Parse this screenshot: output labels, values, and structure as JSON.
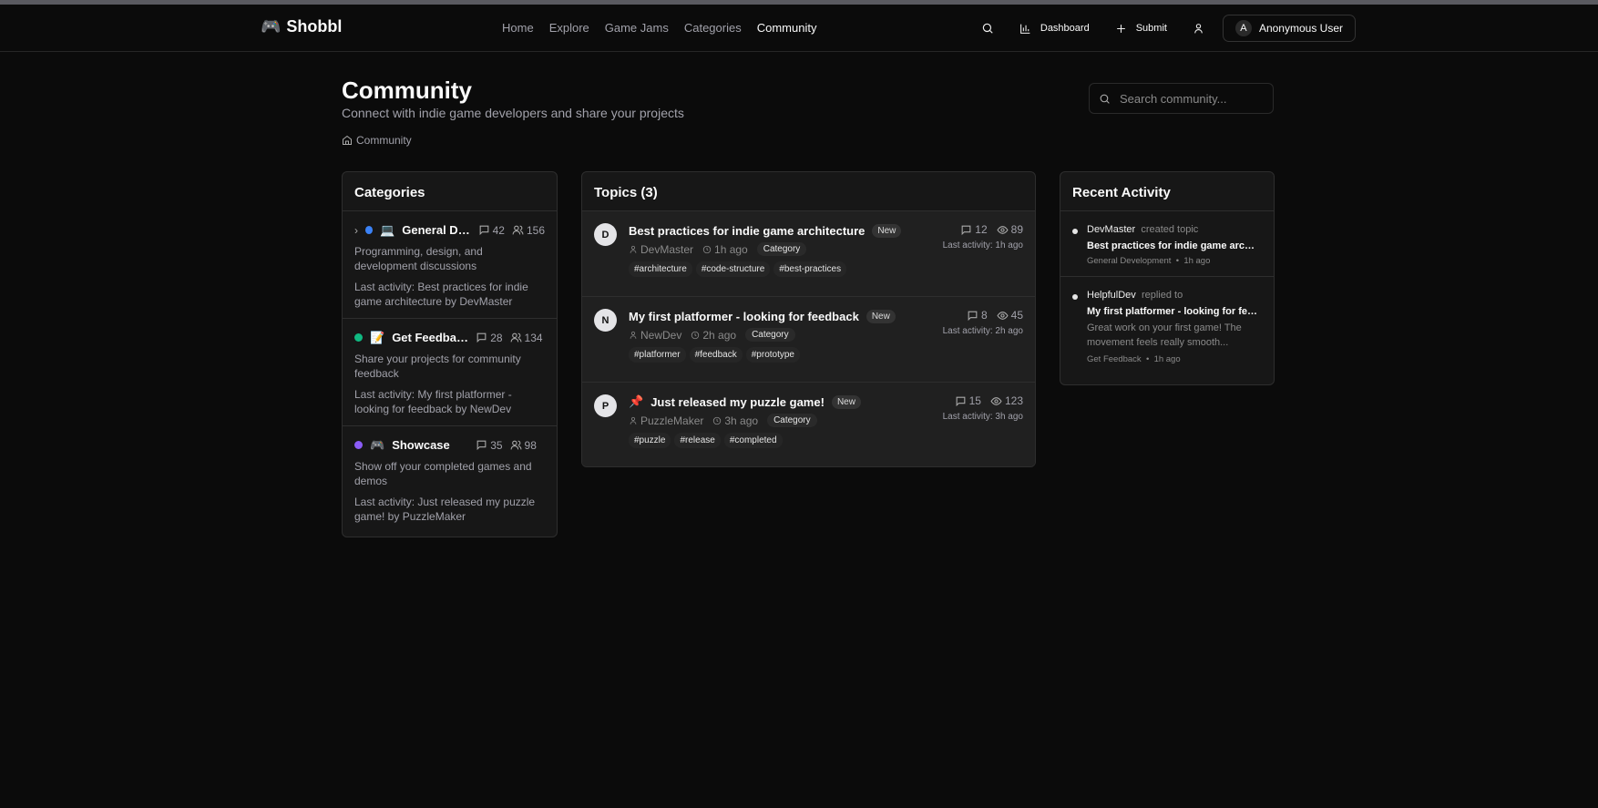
{
  "header": {
    "logo": "Shobbl",
    "logo_icon": "🎮",
    "nav": [
      "Home",
      "Explore",
      "Game Jams",
      "Categories",
      "Community"
    ],
    "active_nav": "Community",
    "dashboard": "Dashboard",
    "submit": "Submit",
    "user_initial": "A",
    "user_name": "Anonymous User"
  },
  "page": {
    "title": "Community",
    "subtitle": "Connect with indie game developers and share your projects",
    "breadcrumb": "Community",
    "search_placeholder": "Search community..."
  },
  "categories": {
    "title": "Categories",
    "items": [
      {
        "emoji": "💻",
        "name": "General Development",
        "color": "#3b82f6",
        "topics": "42",
        "members": "156",
        "desc": "Programming, design, and development discussions",
        "last": "Last activity: Best practices for indie game architecture by DevMaster"
      },
      {
        "emoji": "📝",
        "name": "Get Feedback",
        "color": "#10b981",
        "topics": "28",
        "members": "134",
        "desc": "Share your projects for community feedback",
        "last": "Last activity: My first platformer - looking for feedback by NewDev"
      },
      {
        "emoji": "🎮",
        "name": "Showcase",
        "color": "#8b5cf6",
        "topics": "35",
        "members": "98",
        "desc": "Show off your completed games and demos",
        "last": "Last activity: Just released my puzzle game! by PuzzleMaker"
      }
    ]
  },
  "topics": {
    "title": "Topics (3)",
    "items": [
      {
        "initial": "D",
        "title": "Best practices for indie game architecture",
        "badge": "New",
        "author": "DevMaster",
        "time": "1h ago",
        "category": "Category",
        "tags": [
          "#architecture",
          "#code-structure",
          "#best-practices"
        ],
        "replies": "12",
        "views": "89",
        "last": "Last activity: 1h ago",
        "pinned": false
      },
      {
        "initial": "N",
        "title": "My first platformer - looking for feedback",
        "badge": "New",
        "author": "NewDev",
        "time": "2h ago",
        "category": "Category",
        "tags": [
          "#platformer",
          "#feedback",
          "#prototype"
        ],
        "replies": "8",
        "views": "45",
        "last": "Last activity: 2h ago",
        "pinned": false
      },
      {
        "initial": "P",
        "title": "Just released my puzzle game!",
        "badge": "New",
        "author": "PuzzleMaker",
        "time": "3h ago",
        "category": "Category",
        "tags": [
          "#puzzle",
          "#release",
          "#completed"
        ],
        "replies": "15",
        "views": "123",
        "last": "Last activity: 3h ago",
        "pinned": true
      }
    ]
  },
  "activity": {
    "title": "Recent Activity",
    "items": [
      {
        "user": "DevMaster",
        "action": "created topic",
        "topic": "Best practices for indie game architecture",
        "excerpt": null,
        "category": "General Development",
        "time": "1h ago"
      },
      {
        "user": "HelpfulDev",
        "action": "replied to",
        "topic": "My first platformer - looking for feedback",
        "excerpt": "Great work on your first game! The movement feels really smooth...",
        "category": "Get Feedback",
        "time": "1h ago"
      }
    ]
  }
}
